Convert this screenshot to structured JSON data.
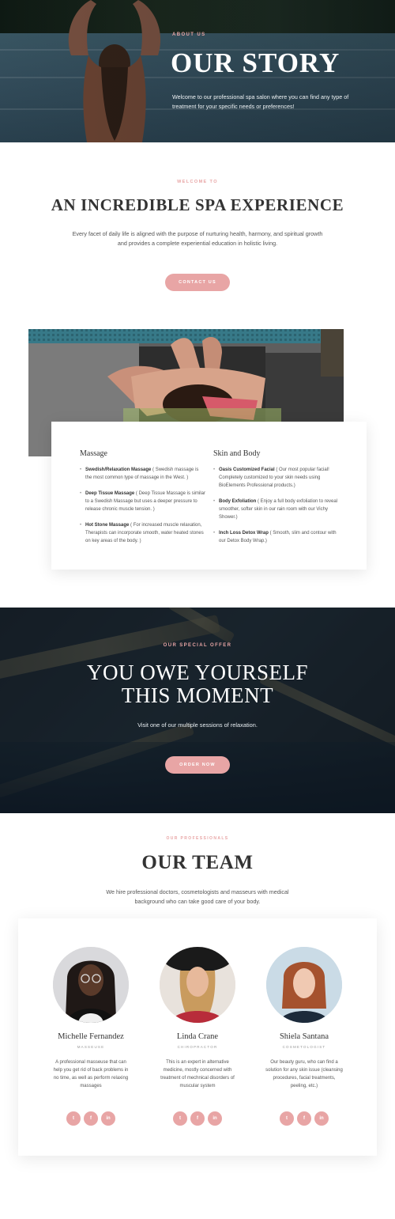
{
  "hero": {
    "eyebrow": "ABOUT US",
    "title": "OUR STORY",
    "lead": "Welcome to our professional spa salon where you can find any type of treatment for your specific needs or preferences!"
  },
  "intro": {
    "eyebrow": "WELCOME TO",
    "title": "AN INCREDIBLE SPA EXPERIENCE",
    "text": "Every facet of daily life is aligned with the purpose of nurturing health, harmony, and spiritual growth and provides a complete experiential education in holistic living.",
    "button": "CONTACT US"
  },
  "services": {
    "columns": [
      {
        "title": "Massage",
        "items": [
          {
            "name": "Swedish/Relaxation Massage",
            "desc": " ( Swedish massage is the most common type of massage in the West. )"
          },
          {
            "name": "Deep Tissue Massage",
            "desc": " ( Deep Tissue Massage is similar to a Swedish Massage but uses a deeper pressure to release chronic muscle tension. )"
          },
          {
            "name": "Hot Stone Massage",
            "desc": " ( For increased muscle relaxation, Therapists can incorporate smooth, water heated stones on key areas of the body. )"
          }
        ]
      },
      {
        "title": "Skin and Body",
        "items": [
          {
            "name": "Oasis Customized Facial",
            "desc": " ( Our most popular facial! Completely customized to your skin needs using BioElements Professional products.)"
          },
          {
            "name": "Body Exfoliation",
            "desc": " ( Enjoy a full body exfoliation to reveal smoother, softer skin in our rain room with our Vichy Shower.)"
          },
          {
            "name": "Inch Loss Detox Wrap",
            "desc": " ( Smooth, slim and contour with our Detox Body Wrap.)"
          }
        ]
      }
    ]
  },
  "offer": {
    "eyebrow": "OUR SPECIAL OFFER",
    "title_line1": "YOU OWE YOURSELF",
    "title_line2": "THIS MOMENT",
    "text": "Visit one of our multiple sessions of relaxation.",
    "button": "ORDER NOW"
  },
  "team": {
    "eyebrow": "OUR PROFESSIONALS",
    "title": "OUR TEAM",
    "text": "We hire professional doctors, cosmetologists and masseurs with medical background who can take good care of your body.",
    "members": [
      {
        "name": "Michelle Fernandez",
        "role": "MASSEUSE",
        "bio": "A professional masseuse that can help you get rid of back problems in no time, as well as perform relaxing massages"
      },
      {
        "name": "Linda Crane",
        "role": "CHIROPRACTOR",
        "bio": "This is an expert in alternative medicine, mostly concerned with treatment of mechnical disorders of muscular system"
      },
      {
        "name": "Shiela Santana",
        "role": "COSMETOLOGIST",
        "bio": "Our beauty guru, who can find a solution for any skin issue (cleansing procedures, facial treatments, peeling, etc.)"
      }
    ],
    "social_labels": [
      "t",
      "f",
      "in"
    ]
  },
  "colors": {
    "accent": "#e8a5a5",
    "heading": "#333333",
    "body": "#555555"
  }
}
